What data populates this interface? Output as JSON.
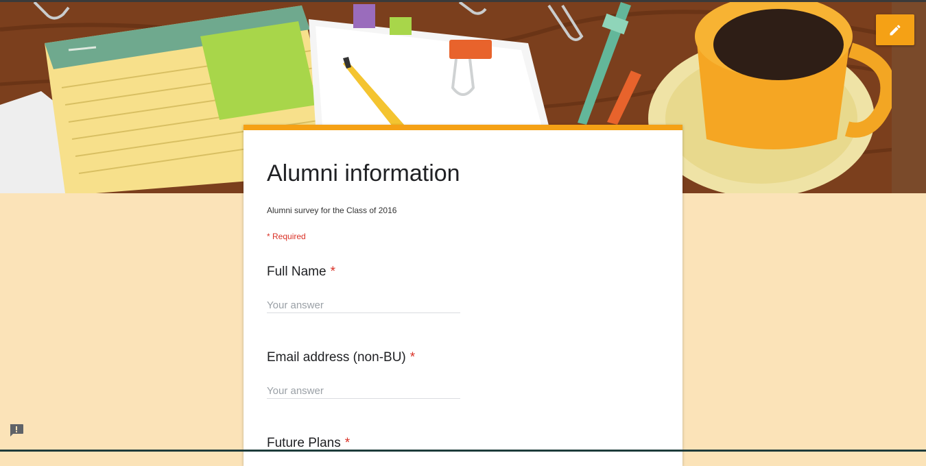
{
  "form": {
    "title": "Alumni information",
    "description": "Alumni survey for the Class of 2016",
    "required_note": "* Required"
  },
  "questions": [
    {
      "label": "Full Name",
      "required_mark": "*",
      "placeholder": "Your answer"
    },
    {
      "label": "Email address (non-BU)",
      "required_mark": "*",
      "placeholder": "Your answer"
    },
    {
      "label": "Future Plans",
      "required_mark": "*"
    }
  ],
  "icons": {
    "edit": "pencil-icon",
    "feedback": "feedback-icon"
  },
  "colors": {
    "accent": "#f5a115",
    "background": "#fbe3b8",
    "required": "#d93025"
  }
}
